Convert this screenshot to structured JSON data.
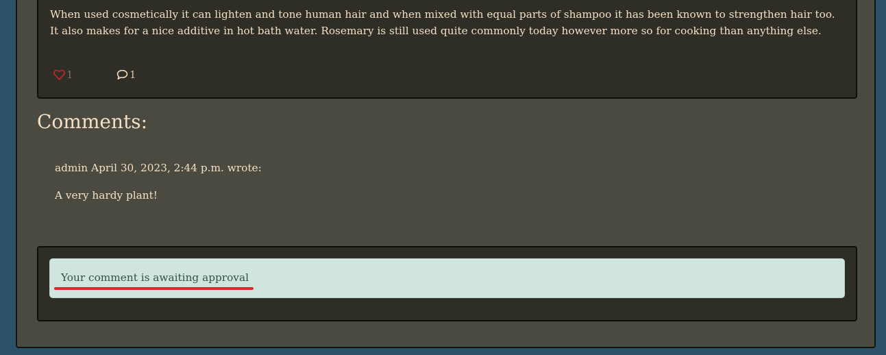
{
  "post": {
    "body_text": "When used cosmetically it can lighten and tone human hair and when mixed with equal parts of shampoo it has been known to strengthen hair too. It also makes for a nice additive in hot bath water. Rosemary is still used quite commonly today however more so for cooking than anything else.",
    "like_count": "1",
    "comment_count": "1",
    "like_icon": "heart-outline-icon",
    "comment_icon": "speech-bubble-icon"
  },
  "comments": {
    "heading": "Comments:",
    "items": [
      {
        "meta": "admin April 30, 2023, 2:44 p.m. wrote:",
        "body": "A very hardy plant!"
      }
    ]
  },
  "approval": {
    "message": "Your comment is awaiting approval"
  },
  "colors": {
    "page_background": "#2b5168",
    "container_background": "#4a4a41",
    "card_background": "#2e2e26",
    "text": "#f5dfc4",
    "heart": "#c8242a",
    "alert_background": "#d0e5dd",
    "alert_text": "#2f5346",
    "highlight_underline": "#d42a2a"
  }
}
